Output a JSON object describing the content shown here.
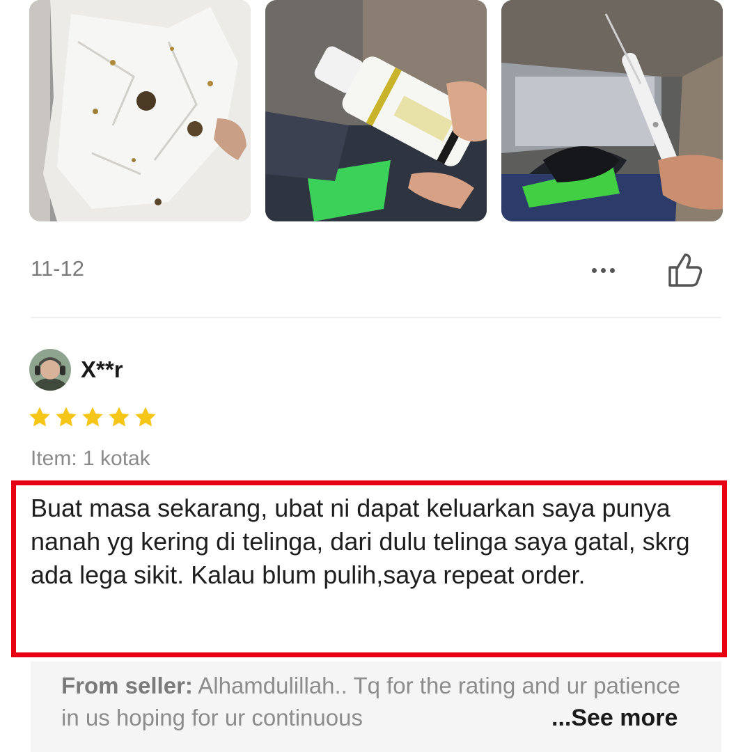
{
  "photos": [
    {
      "icon": "review-photo-tissue"
    },
    {
      "icon": "review-photo-bottle"
    },
    {
      "icon": "review-photo-ear-tool"
    }
  ],
  "review_meta": {
    "date": "11-12",
    "more_icon": "more-icon",
    "like_icon": "thumbs-up-icon"
  },
  "reviewer": {
    "name": "X**r",
    "rating": 5,
    "rating_max": 5,
    "star_color": "#F5C518"
  },
  "review": {
    "variant": "Item: 1 kotak",
    "text": "Buat masa sekarang, ubat ni dapat keluarkan saya punya nanah yg kering di telinga, dari dulu telinga saya gatal, skrg ada lega sikit. Kalau blum pulih,saya repeat order.",
    "highlight_color": "#E60012"
  },
  "seller_reply": {
    "label": "From seller:",
    "text": " Alhamdulillah.. Tq for the rating and ur patience in us   hoping for ur continuous ",
    "see_more": "...See more"
  }
}
